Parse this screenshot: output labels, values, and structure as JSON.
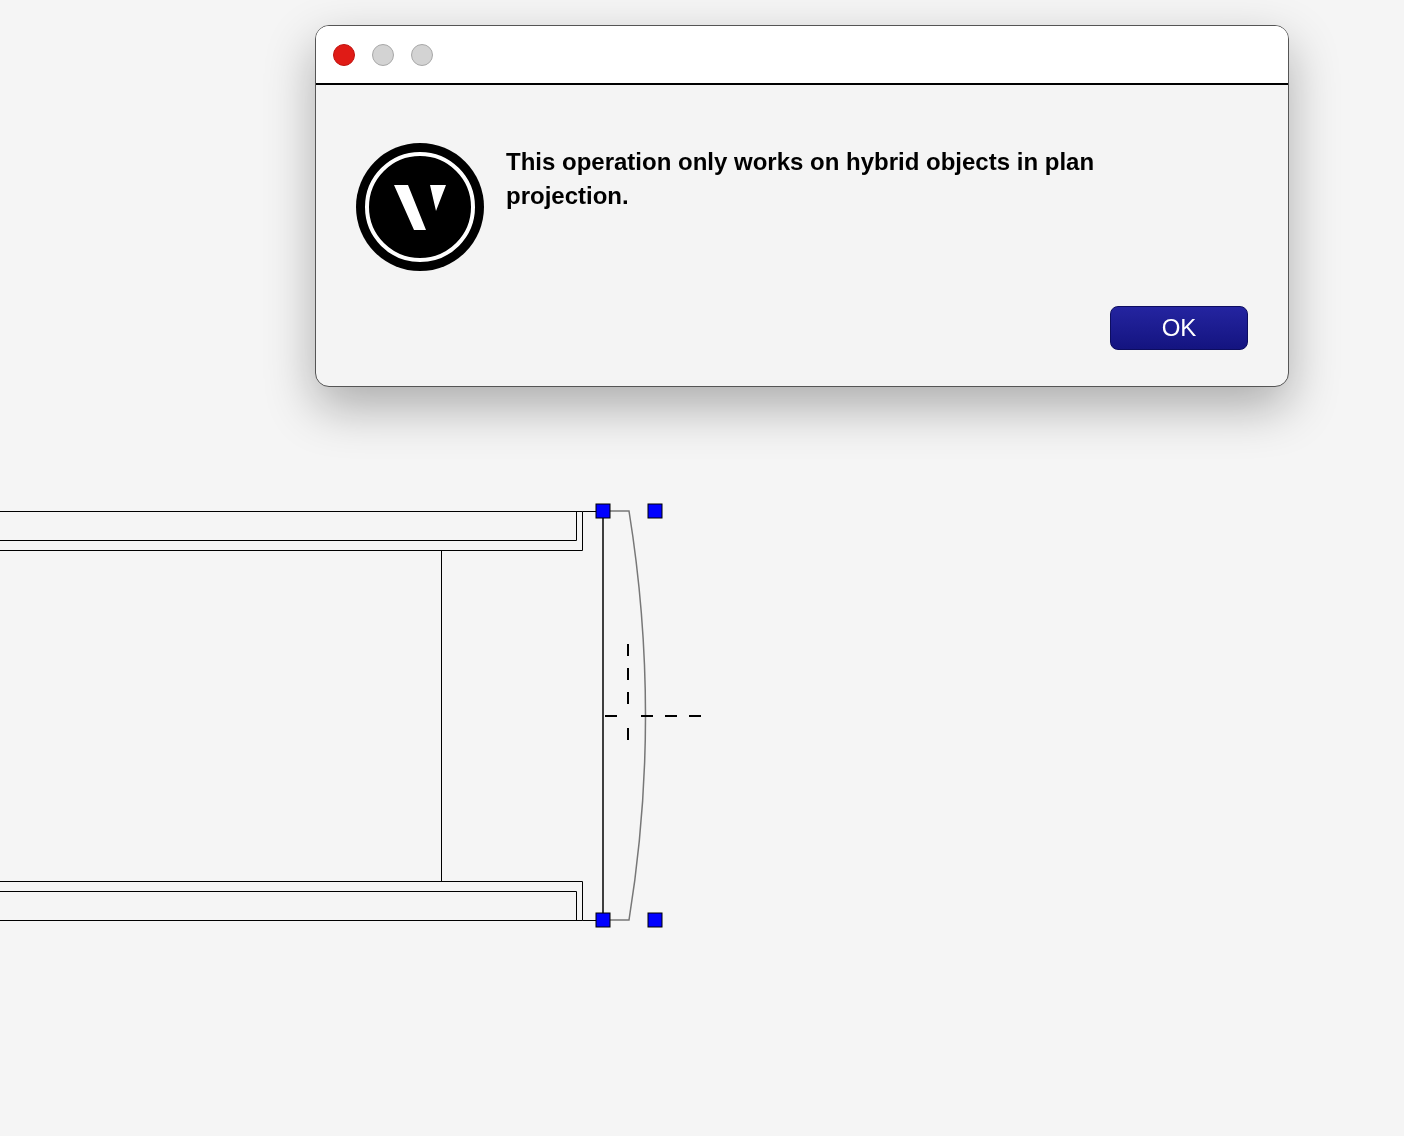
{
  "dialog": {
    "window_controls": [
      {
        "kind": "close"
      },
      {
        "kind": "minimize"
      },
      {
        "kind": "zoom"
      }
    ],
    "message": "This operation only works on hybrid objects in plan projection.",
    "buttons": [
      {
        "label": "OK",
        "default": true
      }
    ]
  }
}
